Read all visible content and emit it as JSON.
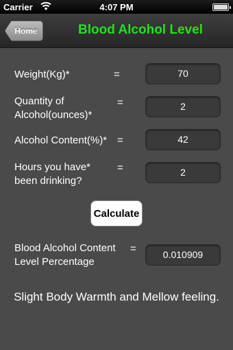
{
  "status_bar": {
    "carrier": "Carrier",
    "time": "4:07 PM"
  },
  "nav": {
    "back_label": "Home",
    "title": "Blood Alcohol Level"
  },
  "form": {
    "weight": {
      "label": "Weight(Kg)*",
      "equals": "=",
      "value": "70"
    },
    "quantity": {
      "label_line1": "Quantity of",
      "label_line2": "Alcohol(ounces)*",
      "equals": "=",
      "value": "2"
    },
    "content": {
      "label": "Alcohol Content(%)*",
      "equals": "=",
      "value": "42"
    },
    "hours": {
      "label_line1": "Hours you have*",
      "label_line2": "been drinking?",
      "equals": "=",
      "value": "2"
    }
  },
  "calculate_label": "Calculate",
  "result": {
    "label_line1": "Blood Alcohol Content",
    "label_line2": "Level Percentage",
    "equals": "=",
    "value": "0.010909"
  },
  "message": "Slight Body Warmth and Mellow feeling.",
  "colors": {
    "title": "#22e022",
    "background": "#4a4a4a"
  }
}
